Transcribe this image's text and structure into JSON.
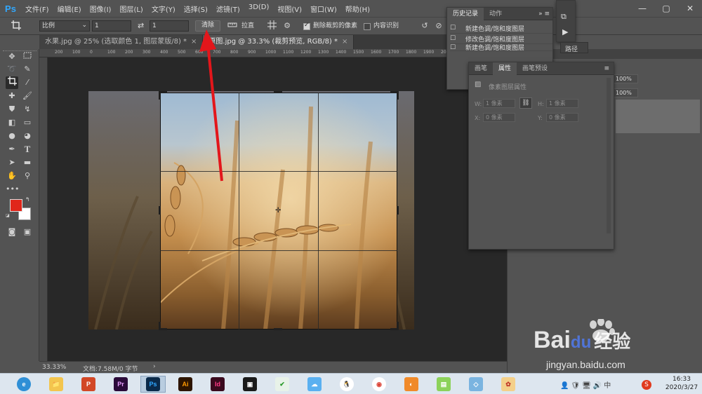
{
  "app": {
    "logo": "Ps"
  },
  "menu": [
    "文件(F)",
    "编辑(E)",
    "图像(I)",
    "图层(L)",
    "文字(Y)",
    "选择(S)",
    "滤镜(T)",
    "3D(D)",
    "视图(V)",
    "窗口(W)",
    "帮助(H)"
  ],
  "window_controls": {
    "minimize": "—",
    "maximize": "▢",
    "close": "✕"
  },
  "options": {
    "ratio_select": "比例",
    "ratio_w": "1",
    "swap_icon": "⇄",
    "ratio_h": "1",
    "clear_label": "清除",
    "straighten_label": "拉直",
    "delete_cropped_label": "删除裁剪的像素",
    "delete_cropped_checked": true,
    "content_aware_label": "内容识别",
    "content_aware_checked": false
  },
  "tabs": [
    {
      "label": "水果.jpg @ 25% (选取颜色 1, 图层蒙版/8) *",
      "close": "×",
      "active": false
    },
    {
      "label": "原图.jpg @ 33.3% (裁剪预览, RGB/8) *",
      "close": "×",
      "active": true
    }
  ],
  "ruler_ticks": [
    "200",
    "100",
    "0",
    "100",
    "200",
    "300",
    "400",
    "500",
    "600",
    "700",
    "800",
    "900",
    "1000",
    "1100",
    "1200",
    "1300",
    "1400",
    "1500",
    "1600",
    "1700",
    "1800",
    "1900",
    "2000",
    "2100",
    "2200"
  ],
  "colors": {
    "foreground": "#e0261a",
    "background": "#ffffff",
    "arrow": "#e3161b",
    "ps_blue": "#31a8ff"
  },
  "history_panel": {
    "tabs": [
      "历史记录",
      "动作"
    ],
    "items": [
      "新建色调/饱和度图层",
      "修改色调/饱和度图层",
      "新建色调/饱和度图层"
    ]
  },
  "mini_panel": {
    "label": "路径"
  },
  "properties_panel": {
    "tabs": [
      "画笔",
      "属性",
      "画笔预设"
    ],
    "title": "像素图层属性",
    "w_label": "W:",
    "w_value": "1 像素",
    "h_label": "H:",
    "h_value": "1 像素",
    "x_label": "X:",
    "x_value": "0 像素",
    "y_label": "Y:",
    "y_value": "0 像素"
  },
  "layers_panel": {
    "opacity": "100%",
    "fill": "100%"
  },
  "status": {
    "zoom": "33.33%",
    "doc": "文档:7.58M/0 字节",
    "arrow": "›"
  },
  "taskbar": {
    "apps": [
      {
        "name": "browser",
        "label": "e"
      },
      {
        "name": "explorer",
        "label": "📁"
      },
      {
        "name": "powerpoint",
        "label": "P"
      },
      {
        "name": "premiere",
        "label": "Pr"
      },
      {
        "name": "photoshop",
        "label": "Ps"
      },
      {
        "name": "illustrator",
        "label": "Ai"
      },
      {
        "name": "indesign",
        "label": "Id"
      },
      {
        "name": "video",
        "label": "▣"
      },
      {
        "name": "app-green",
        "label": "✔"
      },
      {
        "name": "app-chat",
        "label": "☁"
      },
      {
        "name": "qq",
        "label": "🐧"
      },
      {
        "name": "chrome",
        "label": "◉"
      },
      {
        "name": "app-fox",
        "label": "◐"
      },
      {
        "name": "app-notes",
        "label": "▤"
      },
      {
        "name": "app-files",
        "label": "◇"
      },
      {
        "name": "app-game",
        "label": "✿"
      }
    ],
    "time": "16:33",
    "date": "2020/3/27"
  },
  "watermark": {
    "brand": "Bai",
    "brand2": "du",
    "cn": "经验",
    "url": "jingyan.baidu.com"
  }
}
